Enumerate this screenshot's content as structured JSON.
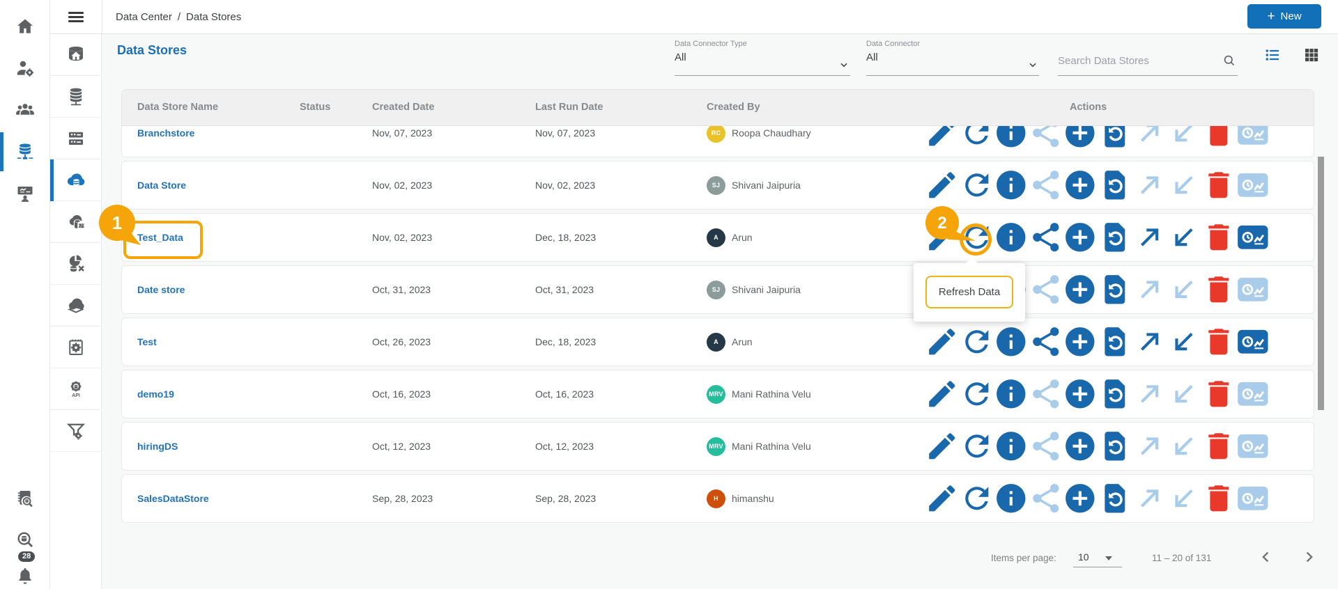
{
  "topbar": {
    "breadcrumb": {
      "parent": "Data Center",
      "separator": "/",
      "current": "Data Stores"
    },
    "new_button": {
      "plus": "+",
      "label": "New"
    }
  },
  "page": {
    "title": "Data Stores"
  },
  "filters": {
    "connector_type": {
      "label": "Data Connector Type",
      "value": "All"
    },
    "connector": {
      "label": "Data Connector",
      "value": "All"
    },
    "search_placeholder": "Search Data Stores"
  },
  "table": {
    "headers": {
      "name": "Data Store Name",
      "status": "Status",
      "created": "Created Date",
      "last_run": "Last Run Date",
      "created_by": "Created By",
      "actions": "Actions"
    },
    "action_icons": [
      "edit-icon",
      "refresh-icon",
      "info-icon",
      "share-icon",
      "add-icon",
      "restore-icon",
      "arrow-up-right-icon",
      "arrow-down-left-icon",
      "delete-icon",
      "run-history-icon"
    ],
    "rows": [
      {
        "name": "Branchstore",
        "status": "",
        "created": "Nov, 07, 2023",
        "last_run": "Nov, 07, 2023",
        "created_by": "Roopa Chaudhary",
        "avatar_initials": "RC",
        "avatar_color": "#e9c229",
        "secondary_actions_enabled": false
      },
      {
        "name": "Data Store",
        "status": "",
        "created": "Nov, 02, 2023",
        "last_run": "Nov, 02, 2023",
        "created_by": "Shivani Jaipuria",
        "avatar_initials": "SJ",
        "avatar_color": "#8c9c9b",
        "secondary_actions_enabled": false
      },
      {
        "name": "Test_Data",
        "status": "",
        "created": "Nov, 02, 2023",
        "last_run": "Dec, 18, 2023",
        "created_by": "Arun",
        "avatar_initials": "A",
        "avatar_color": "#253848",
        "secondary_actions_enabled": true
      },
      {
        "name": "Date store",
        "status": "",
        "created": "Oct, 31, 2023",
        "last_run": "Oct, 31, 2023",
        "created_by": "Shivani Jaipuria",
        "avatar_initials": "SJ",
        "avatar_color": "#8c9c9b",
        "secondary_actions_enabled": false
      },
      {
        "name": "Test",
        "status": "",
        "created": "Oct, 26, 2023",
        "last_run": "Dec, 18, 2023",
        "created_by": "Arun",
        "avatar_initials": "A",
        "avatar_color": "#253848",
        "secondary_actions_enabled": true
      },
      {
        "name": "demo19",
        "status": "",
        "created": "Oct, 16, 2023",
        "last_run": "Oct, 16, 2023",
        "created_by": "Mani Rathina Velu",
        "avatar_initials": "MRV",
        "avatar_color": "#26bd9d",
        "secondary_actions_enabled": false
      },
      {
        "name": "hiringDS",
        "status": "",
        "created": "Oct, 12, 2023",
        "last_run": "Oct, 12, 2023",
        "created_by": "Mani Rathina Velu",
        "avatar_initials": "MRV",
        "avatar_color": "#26bd9d",
        "secondary_actions_enabled": false
      },
      {
        "name": "SalesDataStore",
        "status": "",
        "created": "Sep, 28, 2023",
        "last_run": "Sep, 28, 2023",
        "created_by": "himanshu",
        "avatar_initials": "H",
        "avatar_color": "#ce4f0b",
        "secondary_actions_enabled": false
      }
    ]
  },
  "callouts": {
    "step1": "1",
    "step2": "2",
    "tooltip": "Refresh Data"
  },
  "pagination": {
    "items_per_page_label": "Items per page:",
    "items_per_page_value": "10",
    "range": "11 – 20 of 131"
  },
  "sidebar": {
    "primary_top": [
      {
        "icon": "home-icon",
        "active": false
      },
      {
        "icon": "user-settings-icon",
        "active": false
      },
      {
        "icon": "user-groups-icon",
        "active": false
      },
      {
        "icon": "data-center-icon",
        "active": true
      },
      {
        "icon": "dashboard-person-icon",
        "active": false
      }
    ],
    "primary_bottom": [
      {
        "icon": "data-catalog-search-icon"
      },
      {
        "icon": "data-search-icon"
      },
      {
        "icon": "notifications-bell-icon",
        "badge": "28"
      }
    ],
    "secondary": [
      {
        "icon": "data-home-icon",
        "active": false
      },
      {
        "icon": "database-icon",
        "active": false
      },
      {
        "icon": "server-rack-icon",
        "active": false
      },
      {
        "icon": "cloud-data-store-icon",
        "active": true
      },
      {
        "icon": "cloud-code-icon",
        "active": false
      },
      {
        "icon": "data-transform-icon",
        "active": false
      },
      {
        "icon": "cloud-layers-icon",
        "active": false
      },
      {
        "icon": "document-gear-icon",
        "active": false
      },
      {
        "icon": "api-gear-icon",
        "active": false
      },
      {
        "icon": "funnel-gear-icon",
        "active": false
      }
    ]
  },
  "colors": {
    "accent_blue": "#1b6fb5",
    "action_blue": "#1a68ac",
    "action_blue_disabled": "#a8cce9",
    "danger_red": "#e8392b",
    "callout_orange": "#f5a50a",
    "tooltip_border": "#e7b414",
    "new_button_blue": "#1170b8"
  }
}
